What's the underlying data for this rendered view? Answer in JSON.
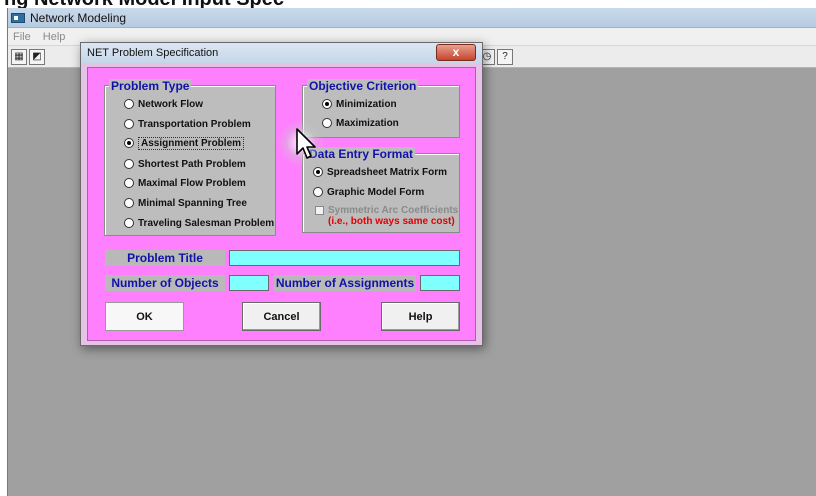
{
  "banner": {
    "text": "ng Network Model Input Spec"
  },
  "app": {
    "title": "Network Modeling",
    "menu": [
      "File",
      "Help"
    ],
    "toolbar_icons": [
      "table-icon",
      "open-folder-icon",
      "clock-icon",
      "help-icon"
    ]
  },
  "dialog": {
    "title": "NET Problem Specification",
    "close_symbol": "x",
    "problem_type": {
      "title": "Problem Type",
      "options": [
        "Network Flow",
        "Transportation Problem",
        "Assignment Problem",
        "Shortest Path Problem",
        "Maximal Flow Problem",
        "Minimal Spanning Tree",
        "Traveling Salesman Problem"
      ],
      "selected": "Assignment Problem"
    },
    "objective": {
      "title": "Objective Criterion",
      "options": [
        "Minimization",
        "Maximization"
      ],
      "selected": "Minimization"
    },
    "data_entry": {
      "title": "Data Entry Format",
      "options": [
        "Spreadsheet Matrix Form",
        "Graphic Model Form"
      ],
      "selected": "Spreadsheet Matrix Form",
      "symmetric_label": "Symmetric Arc Coefficients",
      "symmetric_note": "(i.e., both ways same cost)",
      "symmetric_checked": false
    },
    "fields": {
      "problem_title_label": "Problem Title",
      "problem_title_value": "",
      "objects_label": "Number of Objects",
      "objects_value": "",
      "assignments_label": "Number of Assignments",
      "assignments_value": ""
    },
    "buttons": {
      "ok": "OK",
      "cancel": "Cancel",
      "help": "Help"
    }
  },
  "colors": {
    "dialog_body": "#ff80ff",
    "input_fill": "#80ffff",
    "group_title": "#1212a8",
    "note_red": "#e30000"
  }
}
